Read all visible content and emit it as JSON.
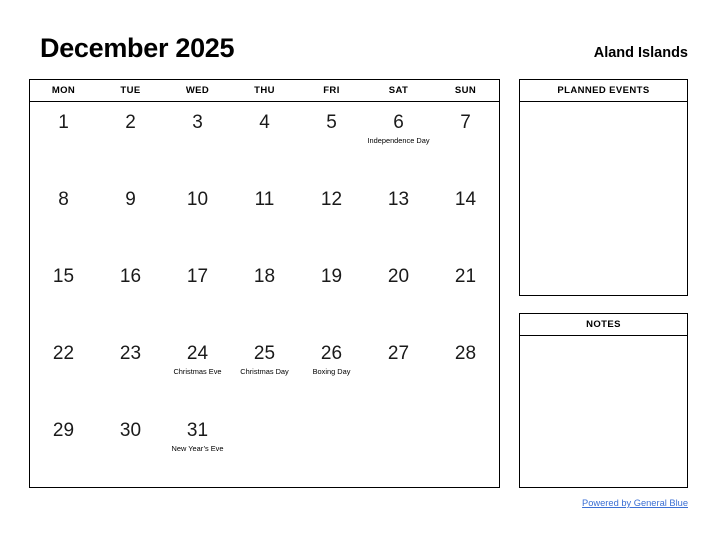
{
  "header": {
    "month_title": "December 2025",
    "country": "Aland Islands"
  },
  "calendar": {
    "weekdays": [
      "MON",
      "TUE",
      "WED",
      "THU",
      "FRI",
      "SAT",
      "SUN"
    ],
    "weeks": [
      [
        {
          "day": "1",
          "event": ""
        },
        {
          "day": "2",
          "event": ""
        },
        {
          "day": "3",
          "event": ""
        },
        {
          "day": "4",
          "event": ""
        },
        {
          "day": "5",
          "event": ""
        },
        {
          "day": "6",
          "event": "Independence Day"
        },
        {
          "day": "7",
          "event": ""
        }
      ],
      [
        {
          "day": "8",
          "event": ""
        },
        {
          "day": "9",
          "event": ""
        },
        {
          "day": "10",
          "event": ""
        },
        {
          "day": "11",
          "event": ""
        },
        {
          "day": "12",
          "event": ""
        },
        {
          "day": "13",
          "event": ""
        },
        {
          "day": "14",
          "event": ""
        }
      ],
      [
        {
          "day": "15",
          "event": ""
        },
        {
          "day": "16",
          "event": ""
        },
        {
          "day": "17",
          "event": ""
        },
        {
          "day": "18",
          "event": ""
        },
        {
          "day": "19",
          "event": ""
        },
        {
          "day": "20",
          "event": ""
        },
        {
          "day": "21",
          "event": ""
        }
      ],
      [
        {
          "day": "22",
          "event": ""
        },
        {
          "day": "23",
          "event": ""
        },
        {
          "day": "24",
          "event": "Christmas Eve"
        },
        {
          "day": "25",
          "event": "Christmas Day"
        },
        {
          "day": "26",
          "event": "Boxing Day"
        },
        {
          "day": "27",
          "event": ""
        },
        {
          "day": "28",
          "event": ""
        }
      ],
      [
        {
          "day": "29",
          "event": ""
        },
        {
          "day": "30",
          "event": ""
        },
        {
          "day": "31",
          "event": "New Year’s Eve"
        },
        {
          "day": "",
          "event": ""
        },
        {
          "day": "",
          "event": ""
        },
        {
          "day": "",
          "event": ""
        },
        {
          "day": "",
          "event": ""
        }
      ]
    ]
  },
  "panels": {
    "planned_events": {
      "title": "PLANNED EVENTS",
      "content": ""
    },
    "notes": {
      "title": "NOTES",
      "content": ""
    }
  },
  "footer": {
    "link_text": "Powered by General Blue",
    "link_color": "#3b6fd4"
  }
}
